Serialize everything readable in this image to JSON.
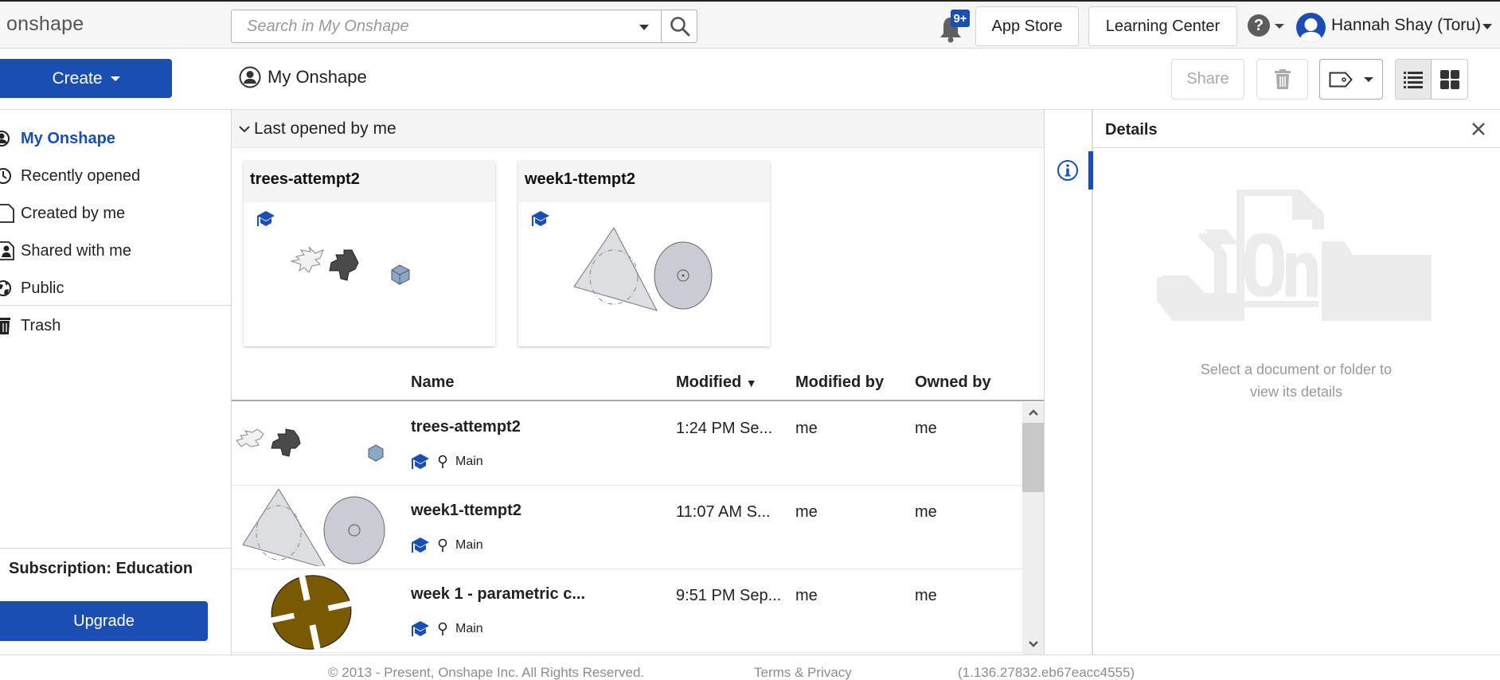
{
  "header": {
    "logo": "onshape",
    "search_placeholder": "Search in My Onshape",
    "search_value": "",
    "notification_badge": "9+",
    "app_store_label": "App Store",
    "learning_center_label": "Learning Center",
    "help_glyph": "?",
    "user_name": "Hannah Shay (Toru)"
  },
  "toolbar": {
    "create_label": "Create",
    "page_title": "My Onshape",
    "share_label": "Share",
    "view_mode": "list"
  },
  "sidebar": {
    "items": [
      {
        "label": "My Onshape",
        "icon": "user-circle-icon",
        "active": true
      },
      {
        "label": "Recently opened",
        "icon": "clock-icon",
        "active": false
      },
      {
        "label": "Created by me",
        "icon": "document-icon",
        "active": false
      },
      {
        "label": "Shared with me",
        "icon": "shared-user-icon",
        "active": false
      },
      {
        "label": "Public",
        "icon": "globe-icon",
        "active": false
      },
      {
        "label": "Trash",
        "icon": "trash-icon",
        "active": false
      }
    ],
    "subscription_label": "Subscription: Education",
    "upgrade_label": "Upgrade"
  },
  "main": {
    "section_title": "Last opened by me",
    "cards": [
      {
        "title": "trees-attempt2",
        "thumbnail": "trees"
      },
      {
        "title": "week1-ttempt2",
        "thumbnail": "triangle-disc"
      }
    ],
    "columns": {
      "name": "Name",
      "modified": "Modified",
      "sort_indicator": "▼",
      "modified_by": "Modified by",
      "owned_by": "Owned by"
    },
    "rows": [
      {
        "name": "trees-attempt2",
        "branch": "Main",
        "modified": "1:24 PM Se...",
        "modified_by": "me",
        "owned_by": "me",
        "thumbnail": "trees"
      },
      {
        "name": "week1-ttempt2",
        "branch": "Main",
        "modified": "11:07 AM S...",
        "modified_by": "me",
        "owned_by": "me",
        "thumbnail": "triangle-disc"
      },
      {
        "name": "week 1 - parametric c...",
        "branch": "Main",
        "modified": "9:51 PM Sep...",
        "modified_by": "me",
        "owned_by": "me",
        "thumbnail": "brown-disc"
      }
    ]
  },
  "details": {
    "title": "Details",
    "empty_line1": "Select a document or folder to",
    "empty_line2": "view its details"
  },
  "footer": {
    "copyright": "© 2013 - Present, Onshape Inc. All Rights Reserved.",
    "terms": "Terms & Privacy",
    "version": "(1.136.27832.eb67eacc4555)"
  },
  "colors": {
    "accent": "#1a4fb1",
    "header_bg": "#f6f6f6",
    "section_bg": "#f4f4f4",
    "muted_text": "#999999",
    "thumb_brown": "#7a5a00"
  }
}
